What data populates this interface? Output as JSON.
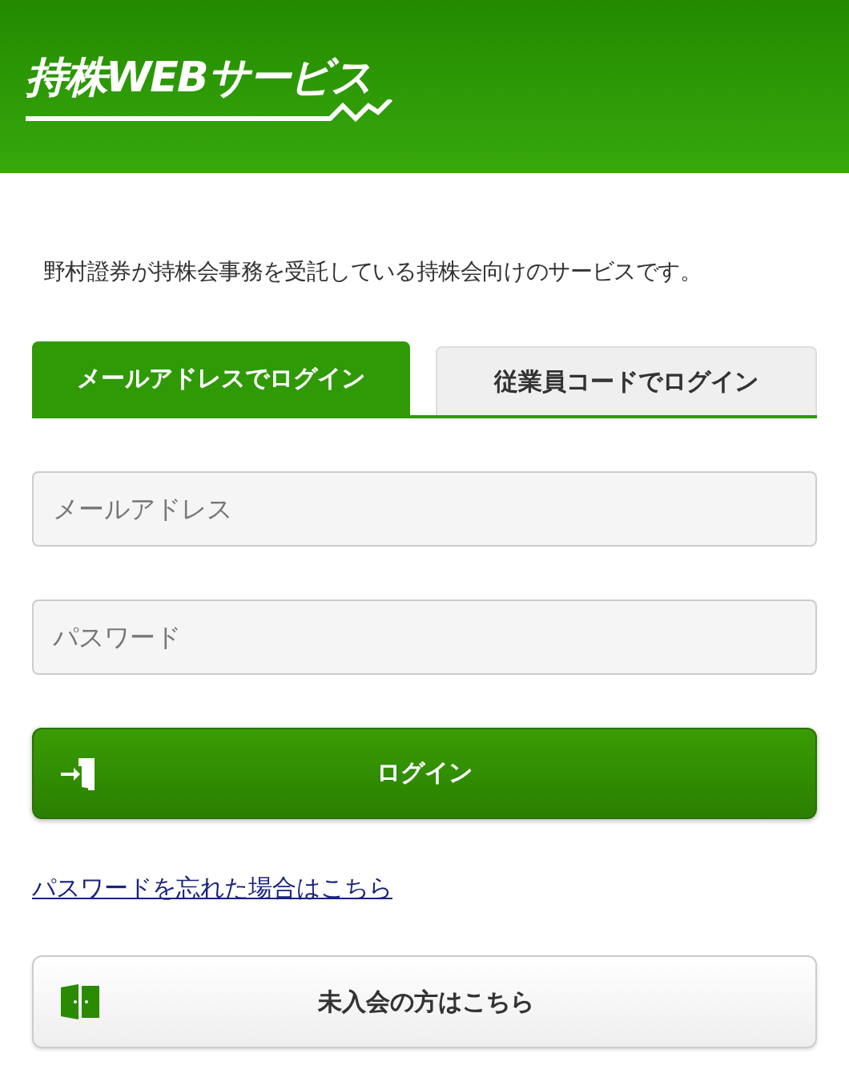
{
  "header": {
    "logo": "持株WEBサービス"
  },
  "description": "野村證券が持株会事務を受託している持株会向けのサービスです。",
  "tabs": [
    {
      "label": "メールアドレスでログイン",
      "selected": true
    },
    {
      "label": "従業員コードでログイン",
      "selected": false
    }
  ],
  "fields": [
    {
      "placeholder": "メールアドレス"
    },
    {
      "placeholder": "パスワード"
    }
  ],
  "login_button": {
    "label": "ログイン"
  },
  "forgot_link": "パスワードを忘れた場合はこちら",
  "join_button": {
    "label": "未入会の方はこちら"
  }
}
